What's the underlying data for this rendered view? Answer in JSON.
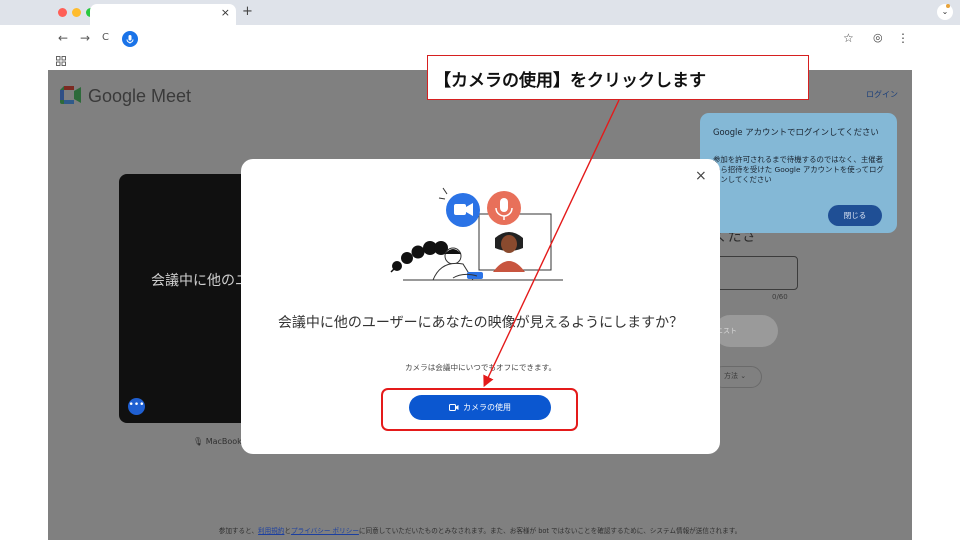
{
  "browser": {
    "new_tab": "+",
    "tab_close": "×",
    "tab_menu": "⌄",
    "nav_back": "←",
    "nav_forward": "→",
    "nav_reload": "C",
    "bookmark_star": "☆",
    "profile": "◎",
    "menu": "⋮"
  },
  "page": {
    "brand": "Google Meet",
    "login": "ログイン",
    "preview_text": "会議中に他のユ",
    "preview_more": "•••",
    "mic_label": "MacBook",
    "partial_heading": "くださ",
    "char_count": "0/60",
    "ask_label": "ニスト",
    "other_ways_label": "方法 ⌄",
    "footer": {
      "prefix": "参加すると、",
      "terms": "利用規約",
      "and": "と",
      "privacy": "プライバシー ポリシー",
      "suffix": "に同意していただいたものとみなされます。また、お客様が bot ではないことを確認するために、システム情報が送信されます。"
    }
  },
  "tooltip": {
    "title": "Google アカウントでログインしてください",
    "body": "参加を許可されるまで待機するのではなく、主催者から招待を受けた Google アカウントを使ってログインしてください",
    "close": "閉じる"
  },
  "modal": {
    "close": "×",
    "title": "会議中に他のユーザーにあなたの映像が見えるようにしますか？",
    "subtitle": "カメラは会議中にいつでもオフにできます。",
    "camera_button": "カメラの使用"
  },
  "annotation": {
    "callout": "【カメラの使用】をクリックします"
  },
  "colors": {
    "accent": "#0b57d0",
    "annotation_red": "#e41a1a",
    "tooltip": "#84b8d6"
  }
}
